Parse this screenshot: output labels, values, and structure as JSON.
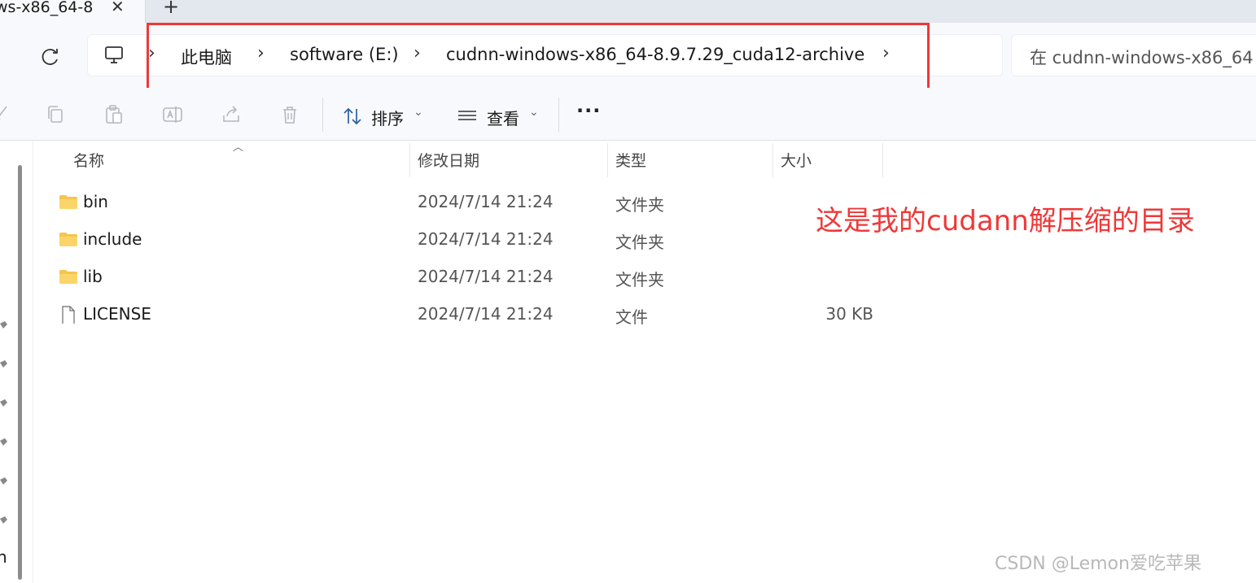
{
  "tab": {
    "title": "ws-x86_64-8",
    "close_glyph": "✕",
    "new_tab_glyph": "+"
  },
  "address": {
    "crumbs": [
      "此电脑",
      "software (E:)",
      "cudnn-windows-x86_64-8.9.7.29_cuda12-archive"
    ],
    "separator": "›"
  },
  "search": {
    "placeholder": "在 cudnn-windows-x86_64"
  },
  "toolbar": {
    "sort_label": "排序",
    "view_label": "查看",
    "more_label": "···",
    "caret": "⌄",
    "icons": [
      "cut-icon",
      "copy-icon",
      "paste-icon",
      "rename-icon",
      "share-icon",
      "delete-icon"
    ]
  },
  "columns": {
    "name": "名称",
    "modified": "修改日期",
    "type": "类型",
    "size": "大小"
  },
  "files": [
    {
      "name": "bin",
      "modified": "2024/7/14 21:24",
      "type": "文件夹",
      "size": "",
      "icon": "folder-icon"
    },
    {
      "name": "include",
      "modified": "2024/7/14 21:24",
      "type": "文件夹",
      "size": "",
      "icon": "folder-icon"
    },
    {
      "name": "lib",
      "modified": "2024/7/14 21:24",
      "type": "文件夹",
      "size": "",
      "icon": "folder-icon"
    },
    {
      "name": "LICENSE",
      "modified": "2024/7/14 21:24",
      "type": "文件",
      "size": "30 KB",
      "icon": "file-icon"
    }
  ],
  "left_pane": {
    "fragment": "n"
  },
  "annotation": "这是我的cudann解压缩的目录",
  "watermark": "CSDN @Lemon爱吃苹果",
  "colors": {
    "annotation": "#ef3838",
    "folder": "#f6c54b"
  }
}
